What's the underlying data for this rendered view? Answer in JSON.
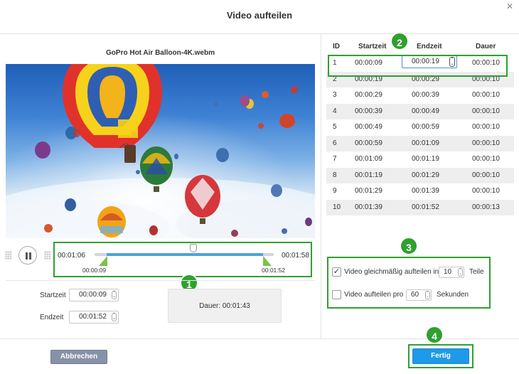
{
  "dialog": {
    "title": "Video aufteilen",
    "close_glyph": "✕"
  },
  "player": {
    "filename": "GoPro Hot Air Balloon-4K.webm",
    "current_time": "00:01:06",
    "total_time": "00:01:58",
    "range_start": "00:00:09",
    "range_end": "00:01:52",
    "play_state_icon": "pause-icon"
  },
  "fields": {
    "start_label": "Startzeit",
    "start_value": "00:00:09",
    "end_label": "Endzeit",
    "end_value": "00:01:52",
    "duration_label": "Dauer:",
    "duration_value": "00:01:43"
  },
  "table": {
    "headers": {
      "id": "ID",
      "start": "Startzeit",
      "end": "Endzeit",
      "duration": "Dauer"
    },
    "rows": [
      {
        "id": "1",
        "start": "00:00:09",
        "end": "00:00:19",
        "duration": "00:00:10"
      },
      {
        "id": "2",
        "start": "00:00:19",
        "end": "00:00:29",
        "duration": "00:00:10"
      },
      {
        "id": "3",
        "start": "00:00:29",
        "end": "00:00:39",
        "duration": "00:00:10"
      },
      {
        "id": "4",
        "start": "00:00:39",
        "end": "00:00:49",
        "duration": "00:00:10"
      },
      {
        "id": "5",
        "start": "00:00:49",
        "end": "00:00:59",
        "duration": "00:00:10"
      },
      {
        "id": "6",
        "start": "00:00:59",
        "end": "00:01:09",
        "duration": "00:00:10"
      },
      {
        "id": "7",
        "start": "00:01:09",
        "end": "00:01:19",
        "duration": "00:00:10"
      },
      {
        "id": "8",
        "start": "00:01:19",
        "end": "00:01:29",
        "duration": "00:00:10"
      },
      {
        "id": "9",
        "start": "00:01:29",
        "end": "00:01:39",
        "duration": "00:00:10"
      },
      {
        "id": "10",
        "start": "00:01:39",
        "end": "00:01:52",
        "duration": "00:00:13"
      }
    ]
  },
  "options": {
    "equal_checked": true,
    "equal_label": "Video gleichmäßig aufteilen in",
    "equal_value": "10",
    "equal_unit": "Teile",
    "per_checked": false,
    "per_label": "Video aufteilen pro",
    "per_value": "60",
    "per_unit": "Sekunden"
  },
  "footer": {
    "cancel_label": "Abbrechen",
    "done_label": "Fertig"
  },
  "badges": {
    "b1": "1",
    "b2": "2",
    "b3": "3",
    "b4": "4"
  },
  "colors": {
    "accent_green": "#2ea12e",
    "primary_blue": "#1e9ae6",
    "cancel_gray": "#8792a8",
    "track_blue": "#4aa3df"
  }
}
